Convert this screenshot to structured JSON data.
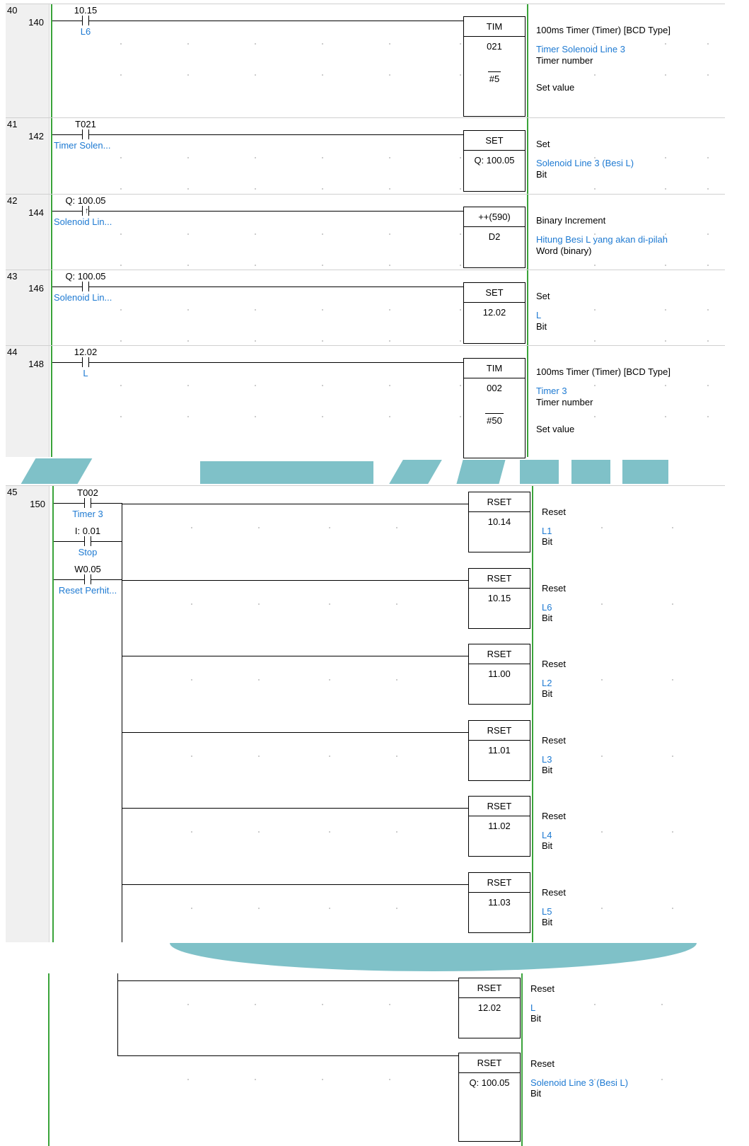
{
  "rungs": [
    {
      "rung_no": "40",
      "step_no": "140",
      "contact": {
        "address": "10.15",
        "symbol": "L6",
        "type": "NO"
      },
      "instruction": {
        "mnemonic": "TIM",
        "operands": [
          "021",
          "#5"
        ]
      },
      "comments": {
        "title": "100ms Timer (Timer) [BCD Type]",
        "op1_symbol": "Timer Solenoid Line 3",
        "op1_desc": "Timer number",
        "op2_desc": "Set value"
      }
    },
    {
      "rung_no": "41",
      "step_no": "142",
      "contact": {
        "address": "T021",
        "symbol": "Timer Solen...",
        "type": "NO"
      },
      "instruction": {
        "mnemonic": "SET",
        "operands": [
          "Q: 100.05"
        ]
      },
      "comments": {
        "title": "Set",
        "op1_symbol": "Solenoid Line 3 (Besi L)",
        "op1_desc": "Bit"
      }
    },
    {
      "rung_no": "42",
      "step_no": "144",
      "contact": {
        "address": "Q: 100.05",
        "symbol": "Solenoid Lin...",
        "type": "Rising edge"
      },
      "instruction": {
        "mnemonic": "++(590)",
        "operands": [
          "D2"
        ]
      },
      "comments": {
        "title": "Binary Increment",
        "op1_symbol": "Hitung Besi L yang akan di-pilah",
        "op1_desc": "Word (binary)"
      }
    },
    {
      "rung_no": "43",
      "step_no": "146",
      "contact": {
        "address": "Q: 100.05",
        "symbol": "Solenoid Lin...",
        "type": "NO"
      },
      "instruction": {
        "mnemonic": "SET",
        "operands": [
          "12.02"
        ]
      },
      "comments": {
        "title": "Set",
        "op1_symbol": "L",
        "op1_desc": "Bit"
      }
    },
    {
      "rung_no": "44",
      "step_no": "148",
      "contact": {
        "address": "12.02",
        "symbol": "L",
        "type": "NO"
      },
      "instruction": {
        "mnemonic": "TIM",
        "operands": [
          "002",
          "#50"
        ]
      },
      "comments": {
        "title": "100ms Timer (Timer) [BCD Type]",
        "op1_symbol": "Timer 3",
        "op1_desc": "Timer number",
        "op2_desc": "Set value"
      }
    }
  ],
  "rung45": {
    "rung_no": "45",
    "step_no": "150",
    "contacts": [
      {
        "address": "T002",
        "symbol": "Timer 3"
      },
      {
        "address": "I: 0.01",
        "symbol": "Stop"
      },
      {
        "address": "W0.05",
        "symbol": "Reset Perhit..."
      }
    ],
    "outputs": [
      {
        "mnemonic": "RSET",
        "operand": "10.14",
        "comment": "Reset",
        "symbol": "L1",
        "desc": "Bit"
      },
      {
        "mnemonic": "RSET",
        "operand": "10.15",
        "comment": "Reset",
        "symbol": "L6",
        "desc": "Bit"
      },
      {
        "mnemonic": "RSET",
        "operand": "11.00",
        "comment": "Reset",
        "symbol": "L2",
        "desc": "Bit"
      },
      {
        "mnemonic": "RSET",
        "operand": "11.01",
        "comment": "Reset",
        "symbol": "L3",
        "desc": "Bit"
      },
      {
        "mnemonic": "RSET",
        "operand": "11.02",
        "comment": "Reset",
        "symbol": "L4",
        "desc": "Bit"
      },
      {
        "mnemonic": "RSET",
        "operand": "11.03",
        "comment": "Reset",
        "symbol": "L5",
        "desc": "Bit"
      },
      {
        "mnemonic": "RSET",
        "operand": "12.02",
        "comment": "Reset",
        "symbol": "L",
        "desc": "Bit"
      },
      {
        "mnemonic": "RSET",
        "operand": "Q: 100.05",
        "comment": "Reset",
        "symbol": "Solenoid Line 3 (Besi L)",
        "desc": "Bit"
      }
    ]
  },
  "colors": {
    "rail": "#3aa33a",
    "symbol_text": "#1e7ad2",
    "watermark": "#7fc1c8"
  }
}
